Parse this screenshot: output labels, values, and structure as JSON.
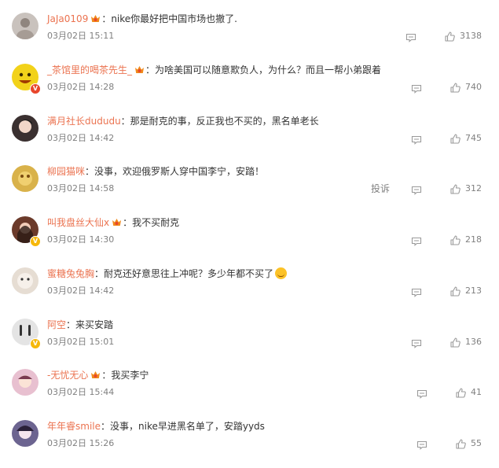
{
  "comments": [
    {
      "username": "JaJa0109",
      "crown": true,
      "text": "：nike你最好把中国市场也撤了.",
      "time": "03月02日 15:11",
      "likes": "3138",
      "report": "",
      "emoji": false,
      "badge": "",
      "avatar_color": "#c9c2bd"
    },
    {
      "username": "_茶馆里的喝茶先生_",
      "crown": true,
      "text": "：为啥美国可以随意欺负人，为什么？而且一帮小弟跟着",
      "time": "03月02日 14:28",
      "likes": "740",
      "report": "",
      "emoji": false,
      "badge": "red",
      "avatar_color": "#f2d21a"
    },
    {
      "username": "满月社长dududu",
      "crown": false,
      "text": "：那是耐克的事，反正我也不买的，黑名单老长",
      "time": "03月02日 14:42",
      "likes": "745",
      "report": "",
      "emoji": false,
      "badge": "",
      "avatar_color": "#3a3030"
    },
    {
      "username": "柳园猫咪",
      "crown": false,
      "text": "：没事，欢迎俄罗斯人穿中国李宁，安踏！",
      "time": "03月02日 14:58",
      "likes": "312",
      "report": "投诉",
      "emoji": false,
      "badge": "",
      "avatar_color": "#d9b24a"
    },
    {
      "username": "叫我盘丝大仙x",
      "crown": true,
      "text": "：我不买耐克",
      "time": "03月02日 14:30",
      "likes": "218",
      "report": "",
      "emoji": false,
      "badge": "yellow",
      "avatar_color": "#6b3a2a"
    },
    {
      "username": "蜜糖兔兔胸",
      "crown": false,
      "text": "：耐克还好意思往上冲呢？多少年都不买了",
      "time": "03月02日 14:42",
      "likes": "213",
      "report": "",
      "emoji": true,
      "badge": "",
      "avatar_color": "#e6ddd3"
    },
    {
      "username": "阿空",
      "crown": false,
      "text": "：来买安踏",
      "time": "03月02日 15:01",
      "likes": "136",
      "report": "",
      "emoji": false,
      "badge": "yellow",
      "avatar_color": "#e4e4e4"
    },
    {
      "username": "-无忧无心",
      "crown": true,
      "text": "：我买李宁",
      "time": "03月02日 15:44",
      "likes": "41",
      "report": "",
      "emoji": false,
      "badge": "",
      "avatar_color": "#e8c0d0"
    },
    {
      "username": "年年睿smile",
      "crown": false,
      "text": "：没事，nike早进黑名单了，安踏yyds",
      "time": "03月02日 15:26",
      "likes": "55",
      "report": "",
      "emoji": false,
      "badge": "",
      "avatar_color": "#6c6490"
    }
  ],
  "colors": {
    "username": "#eb7350",
    "meta": "#808080",
    "text": "#333333"
  }
}
